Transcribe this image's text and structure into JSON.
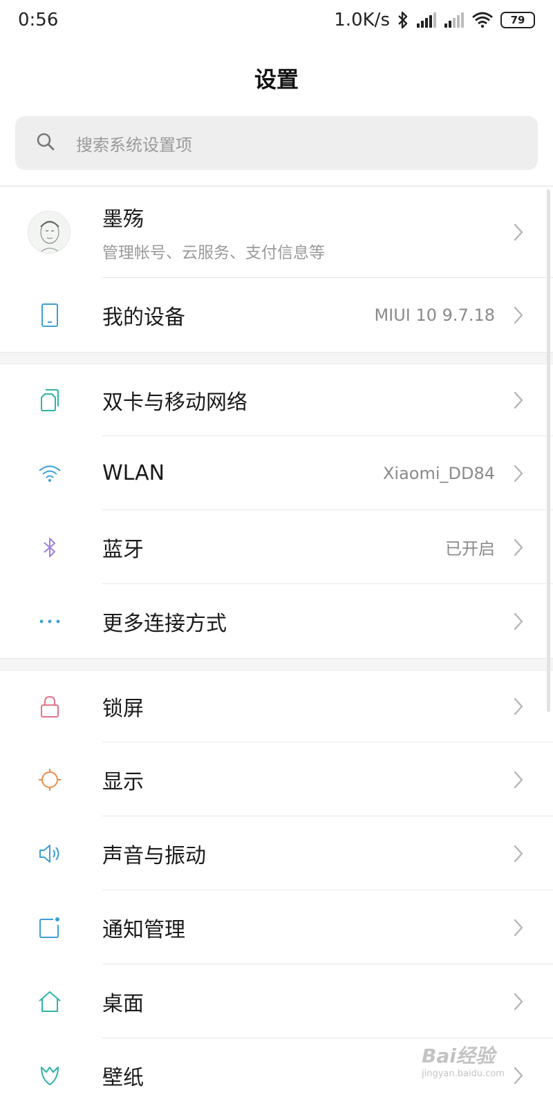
{
  "status_bar": {
    "time": "0:56",
    "network_speed": "1.0K/s",
    "battery": "79",
    "icons": [
      "bluetooth-icon",
      "signal-icon",
      "signal-icon-2",
      "wifi-icon",
      "battery-icon"
    ]
  },
  "header": {
    "title": "设置"
  },
  "search": {
    "placeholder": "搜索系统设置项",
    "icon": "search-icon"
  },
  "account": {
    "name": "墨殇",
    "subtitle": "管理帐号、云服务、支付信息等",
    "icon": "avatar"
  },
  "sections": [
    {
      "items": [
        {
          "label": "我的设备",
          "value": "MIUI 10 9.7.18",
          "icon": "phone-icon",
          "color": "#3a9fd6"
        }
      ]
    },
    {
      "items": [
        {
          "label": "双卡与移动网络",
          "value": "",
          "icon": "sim-card-icon",
          "color": "#2fb3a6"
        },
        {
          "label": "WLAN",
          "value": "Xiaomi_DD84",
          "icon": "wifi-icon",
          "color": "#3a9fd6"
        },
        {
          "label": "蓝牙",
          "value": "已开启",
          "icon": "bluetooth-icon",
          "color": "#9b7ee0"
        },
        {
          "label": "更多连接方式",
          "value": "",
          "icon": "more-dots-icon",
          "color": "#3a9fd6"
        }
      ]
    },
    {
      "items": [
        {
          "label": "锁屏",
          "value": "",
          "icon": "lock-icon",
          "color": "#e0738a"
        },
        {
          "label": "显示",
          "value": "",
          "icon": "sun-icon",
          "color": "#ef8a45"
        },
        {
          "label": "声音与振动",
          "value": "",
          "icon": "speaker-icon",
          "color": "#3a9fd6"
        },
        {
          "label": "通知管理",
          "value": "",
          "icon": "notification-icon",
          "color": "#3a9fd6"
        },
        {
          "label": "桌面",
          "value": "",
          "icon": "home-icon",
          "color": "#2fb3a6"
        },
        {
          "label": "壁纸",
          "value": "",
          "icon": "wallpaper-icon",
          "color": "#2fb3a6"
        }
      ]
    }
  ],
  "watermark": {
    "brand": "Bai经验",
    "url": "jingyan.baidu.com"
  }
}
